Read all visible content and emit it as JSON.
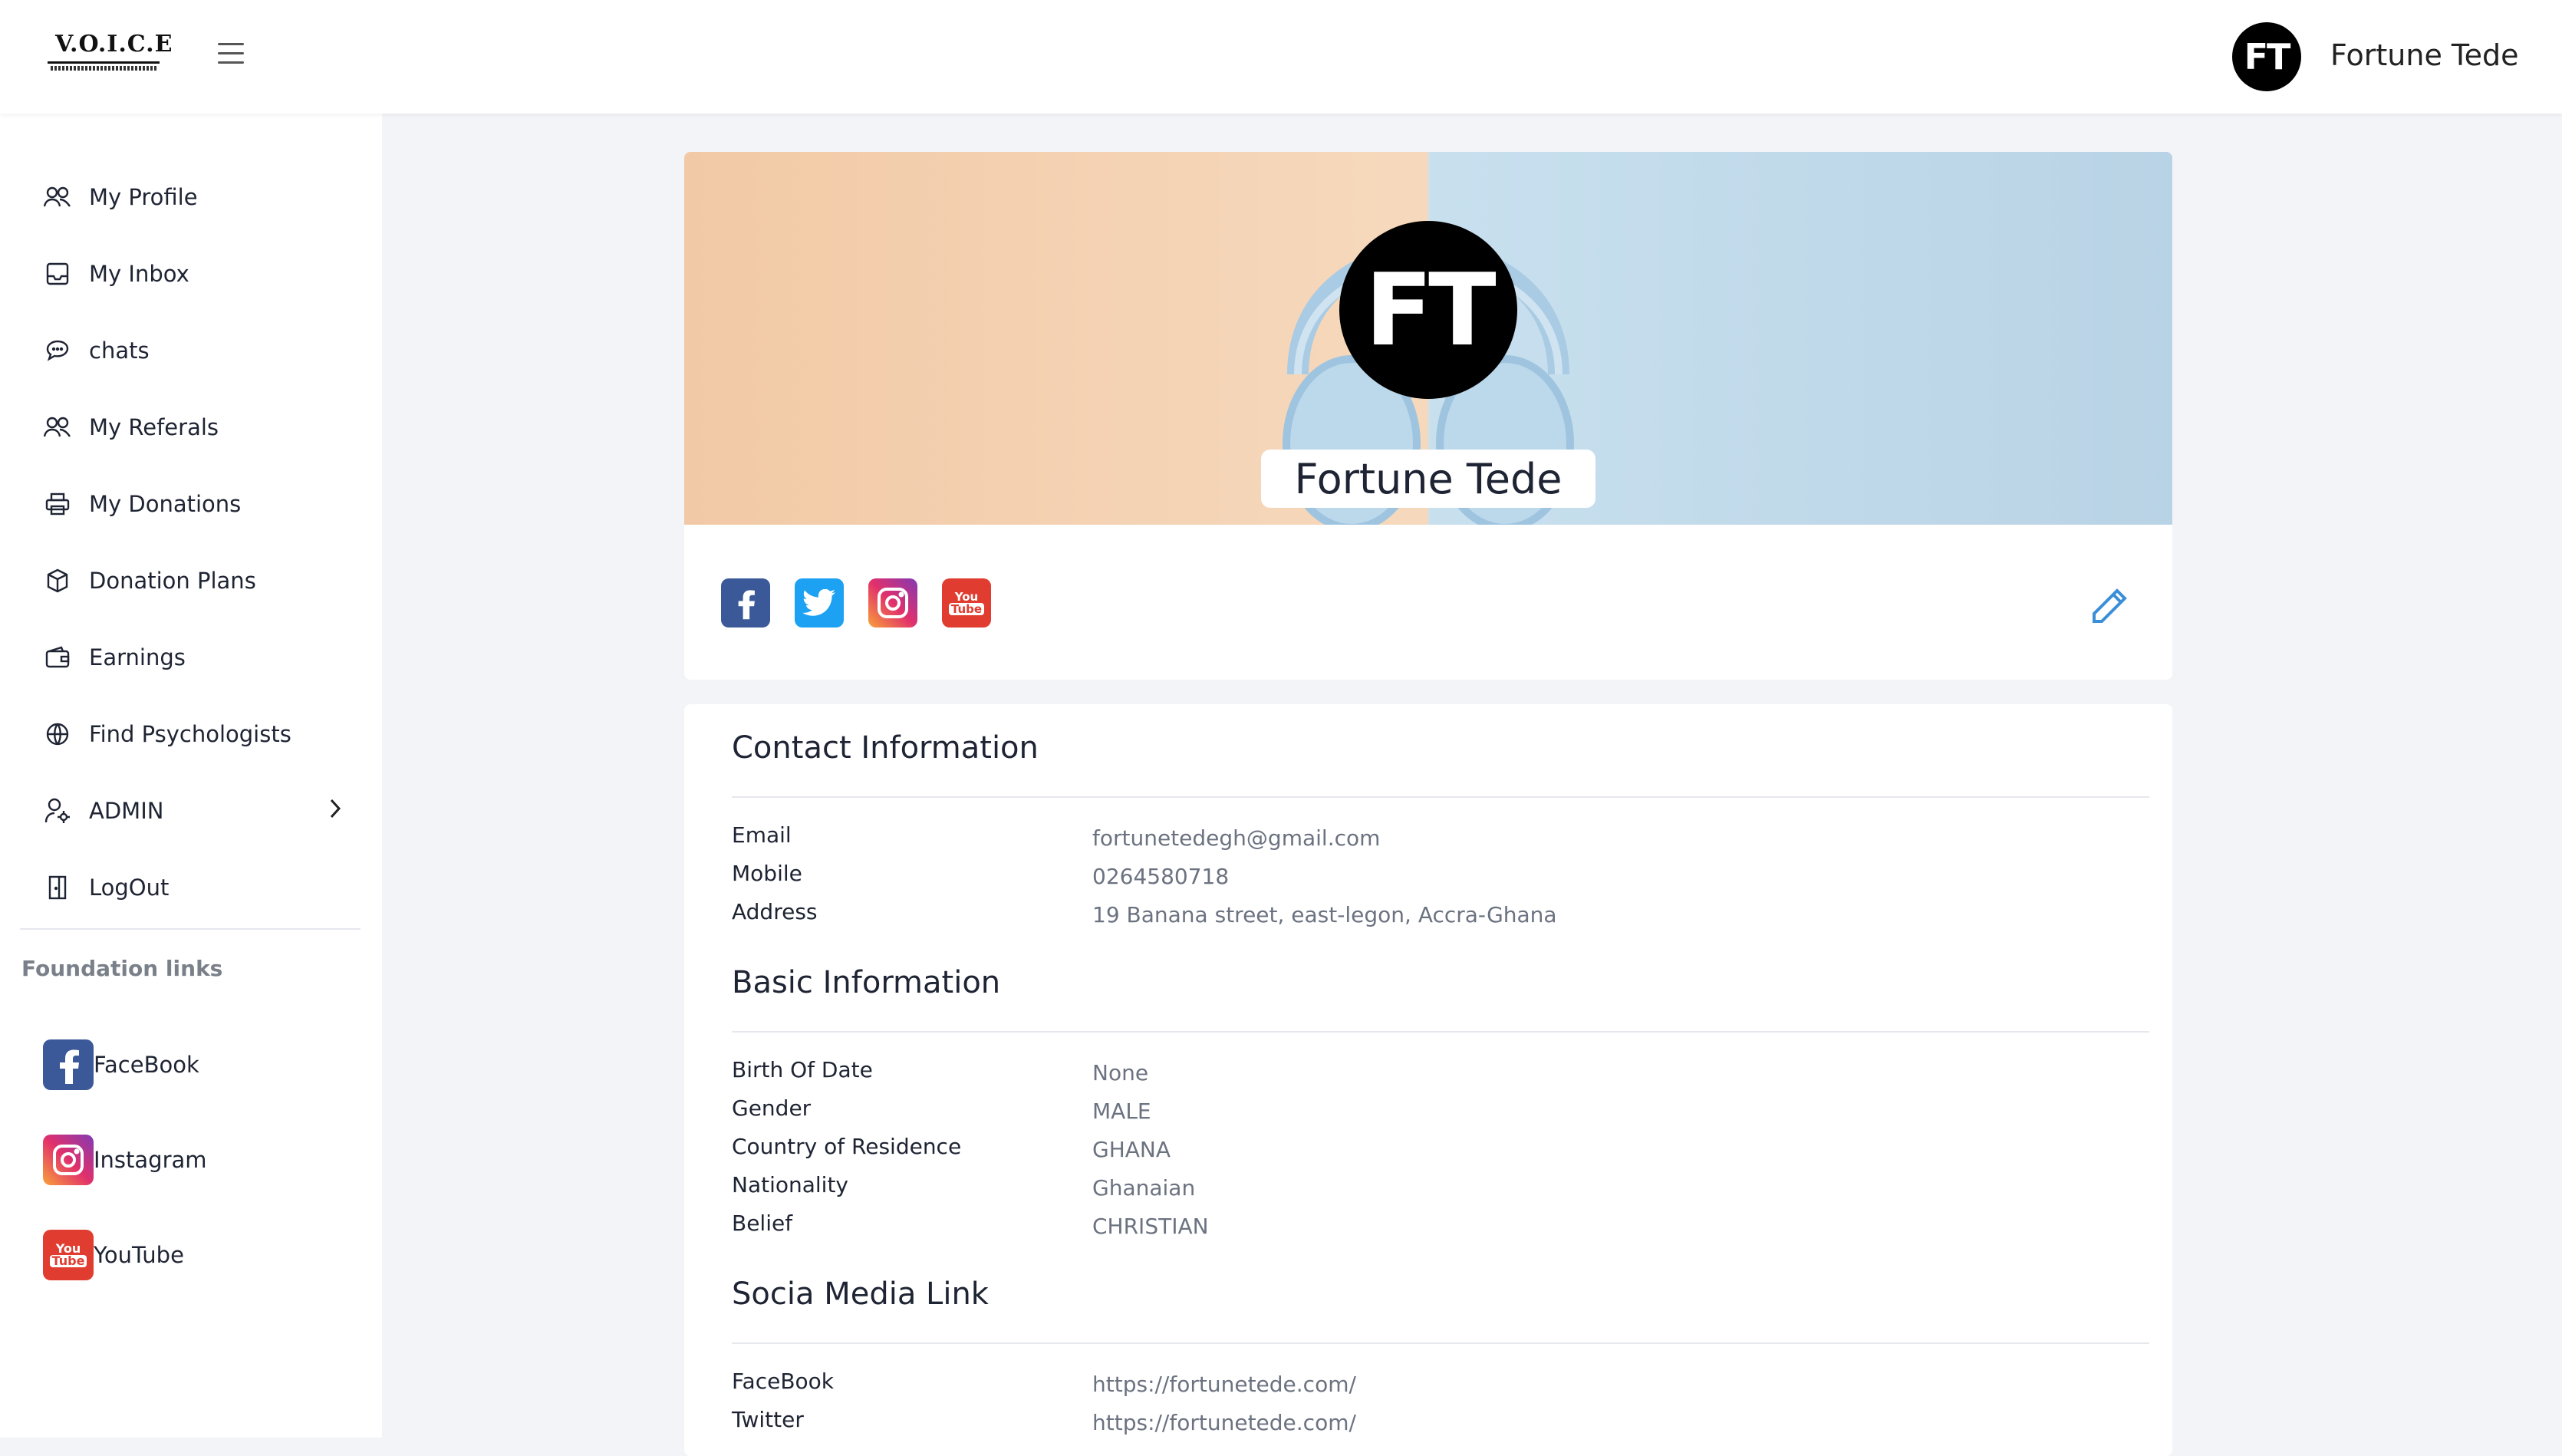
{
  "header": {
    "logo_text": "V.O.I.C.E",
    "user_initials": "FT",
    "user_name": "Fortune Tede"
  },
  "sidebar": {
    "items": [
      {
        "label": "My Profile",
        "icon": "users-icon"
      },
      {
        "label": "My Inbox",
        "icon": "inbox-icon"
      },
      {
        "label": "chats",
        "icon": "chat-icon"
      },
      {
        "label": "My Referals",
        "icon": "users-icon"
      },
      {
        "label": "My Donations",
        "icon": "printer-icon"
      },
      {
        "label": "Donation Plans",
        "icon": "box-icon"
      },
      {
        "label": "Earnings",
        "icon": "wallet-icon"
      },
      {
        "label": "Find Psychologists",
        "icon": "globe-icon"
      },
      {
        "label": "ADMIN",
        "icon": "user-settings-icon"
      },
      {
        "label": "LogOut",
        "icon": "door-icon"
      }
    ],
    "foundation_title": "Foundation links",
    "foundation_links": [
      {
        "label": "FaceBook",
        "icon": "facebook-icon"
      },
      {
        "label": "Instagram",
        "icon": "instagram-icon"
      },
      {
        "label": "YouTube",
        "icon": "youtube-icon"
      }
    ]
  },
  "profile": {
    "initials": "FT",
    "name": "Fortune Tede",
    "social_icons": [
      "facebook-icon",
      "twitter-icon",
      "instagram-icon",
      "youtube-icon"
    ]
  },
  "contact": {
    "title": "Contact Information",
    "rows": [
      {
        "label": "Email",
        "value": "fortunetedegh@gmail.com"
      },
      {
        "label": "Mobile",
        "value": "0264580718"
      },
      {
        "label": "Address",
        "value": "19 Banana street, east-legon, Accra-Ghana"
      }
    ]
  },
  "basic": {
    "title": "Basic Information",
    "rows": [
      {
        "label": "Birth Of Date",
        "value": "None"
      },
      {
        "label": "Gender",
        "value": "MALE"
      },
      {
        "label": "Country of Residence",
        "value": "GHANA"
      },
      {
        "label": "Nationality",
        "value": "Ghanaian"
      },
      {
        "label": "Belief",
        "value": "CHRISTIAN"
      }
    ]
  },
  "social": {
    "title": "Socia Media Link",
    "rows": [
      {
        "label": "FaceBook",
        "value": "https://fortunetede.com/"
      },
      {
        "label": "Twitter",
        "value": "https://fortunetede.com/"
      }
    ]
  }
}
